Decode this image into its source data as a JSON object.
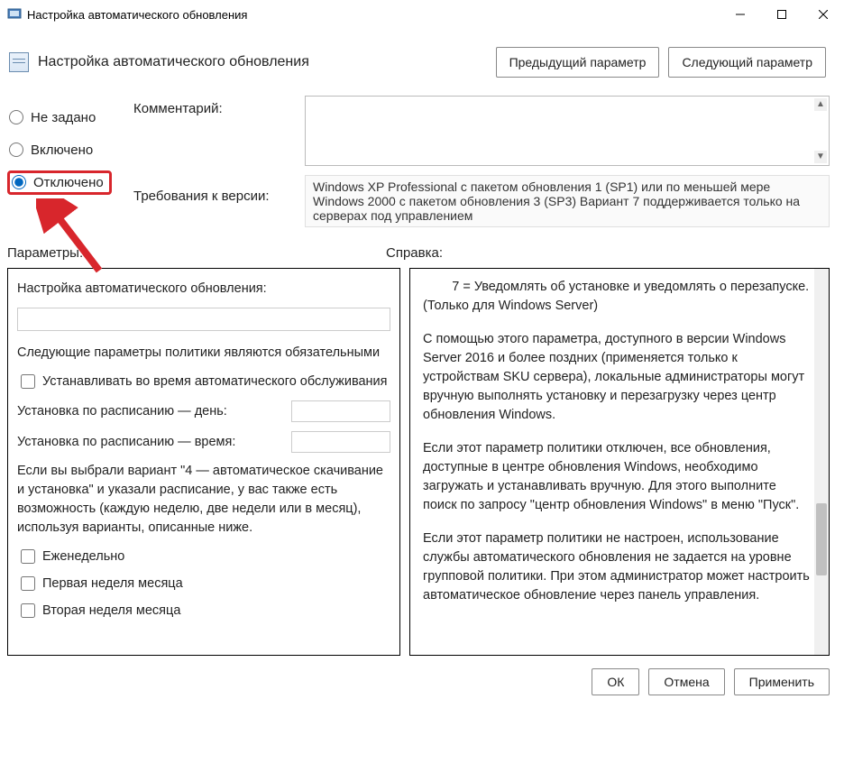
{
  "window": {
    "title": "Настройка автоматического обновления"
  },
  "header": {
    "subtitle": "Настройка автоматического обновления",
    "prev_button": "Предыдущий параметр",
    "next_button": "Следующий параметр"
  },
  "state": {
    "not_configured": "Не задано",
    "enabled": "Включено",
    "disabled": "Отключено",
    "selected": "disabled"
  },
  "labels": {
    "comment": "Комментарий:",
    "requirements": "Требования к версии:",
    "options": "Параметры:",
    "help": "Справка:"
  },
  "requirements_text": "Windows XP Professional с пакетом обновления 1 (SP1) или по меньшей мере Windows 2000 с пакетом обновления 3 (SP3)\nВариант 7 поддерживается только на серверах под управлением",
  "options": {
    "title": "Настройка автоматического обновления:",
    "following": "Следующие параметры политики являются обязательными",
    "chk_maintenance": "Устанавливать во время автоматического обслуживания",
    "sched_day": "Установка по расписанию — день:",
    "sched_time": "Установка по расписанию — время:",
    "note": "Если вы выбрали вариант \"4 — автоматическое скачивание и установка\" и указали расписание, у вас также есть возможность (каждую неделю, две недели или в месяц), используя варианты, описанные ниже.",
    "chk_weekly": "Еженедельно",
    "chk_first_week": "Первая неделя месяца",
    "chk_second_week": "Вторая неделя месяца"
  },
  "help": {
    "p1": "        7 = Уведомлять об установке и уведомлять о перезапуске. (Только для Windows Server)",
    "p2": "С помощью этого параметра, доступного в версии Windows Server 2016 и более поздних (применяется только к устройствам SKU сервера), локальные администраторы могут вручную выполнять установку и перезагрузку через центр обновления Windows.",
    "p3": "Если этот параметр политики отключен, все обновления, доступные в центре обновления Windows, необходимо загружать и устанавливать вручную. Для этого выполните поиск по запросу \"центр обновления Windows\" в меню \"Пуск\".",
    "p4": "Если этот параметр политики не настроен, использование службы автоматического обновления не задается на уровне групповой политики. При этом администратор может настроить автоматическое обновление через панель управления."
  },
  "footer": {
    "ok": "ОК",
    "cancel": "Отмена",
    "apply": "Применить"
  }
}
